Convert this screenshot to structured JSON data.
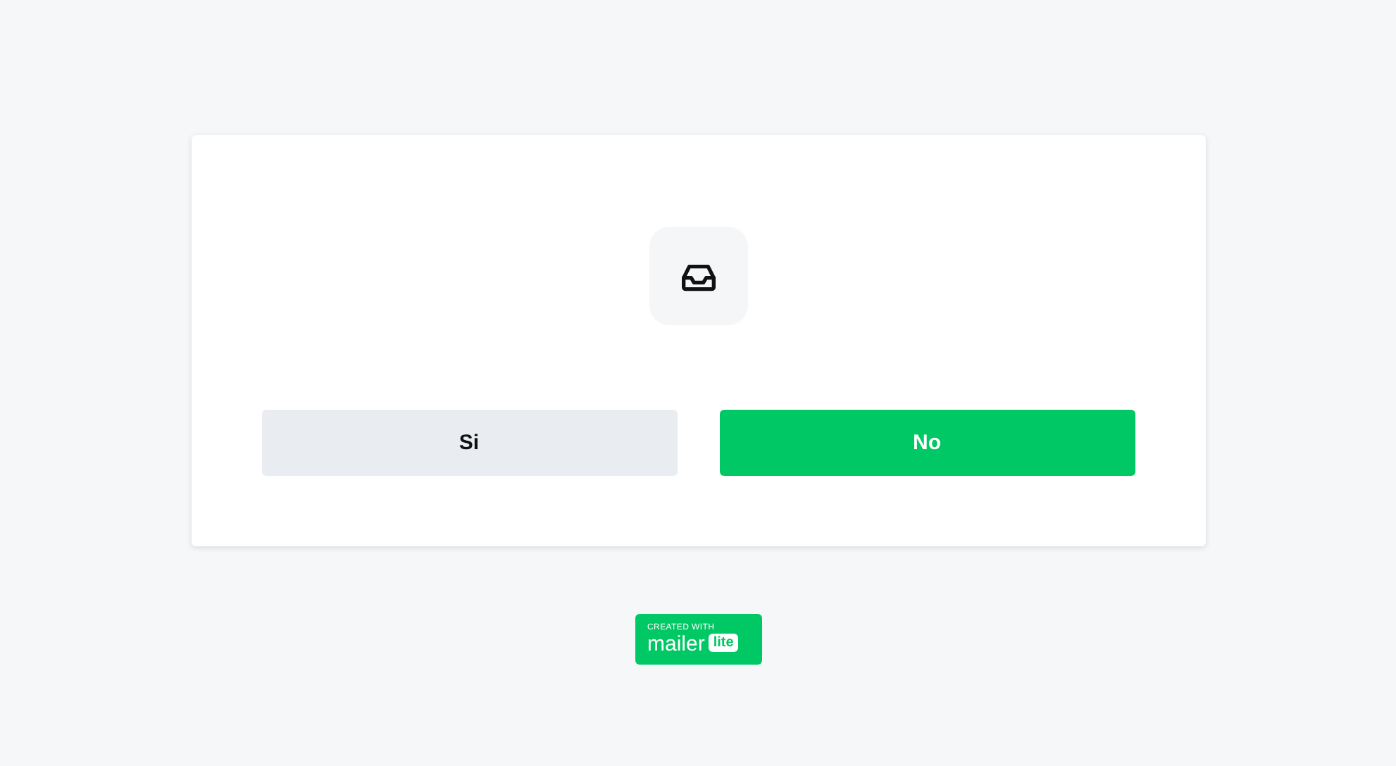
{
  "card": {
    "buttons": [
      {
        "label": "Si",
        "kind": "secondary"
      },
      {
        "label": "No",
        "kind": "primary"
      }
    ]
  },
  "badge": {
    "caption": "CREATED WITH",
    "brand": "mailer",
    "tag": "lite"
  }
}
